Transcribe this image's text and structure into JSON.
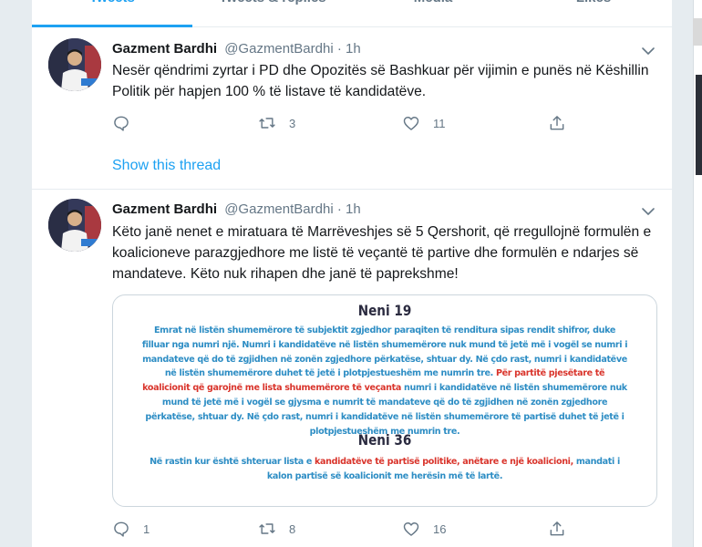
{
  "tabs": [
    {
      "label": "Tweets",
      "active": true
    },
    {
      "label": "Tweets & replies",
      "active": false
    },
    {
      "label": "Media",
      "active": false
    },
    {
      "label": "Likes",
      "active": false
    }
  ],
  "tweets": [
    {
      "name": "Gazment Bardhi",
      "handle": "@GazmentBardhi",
      "dot": "·",
      "time": "1h",
      "text": "Nesër qëndrimi zyrtar i PD dhe Opozitës së Bashkuar për vijimin e punës në Këshillin Politik për hapjen 100 % të listave të kandidatëve.",
      "replies": "",
      "retweets": "3",
      "likes": "11",
      "thread_link": "Show this thread"
    },
    {
      "name": "Gazment Bardhi",
      "handle": "@GazmentBardhi",
      "dot": "·",
      "time": "1h",
      "text": "Këto janë nenet e miratuara të Marrëveshjes së 5 Qershorit, që rregullojnë formulën e koalicioneve parazgjedhore me listë të veçantë të partive dhe formulën e ndarjes së mandateve. Këto nuk rihapen dhe janë të paprekshme!",
      "replies": "1",
      "retweets": "8",
      "likes": "16",
      "media": {
        "title1": "Neni 19",
        "para1_a": "Emrat në listën shumemërore të subjektit zgjedhor paraqiten të renditura sipas rendit shifror, duke filluar nga numri një. Numri i kandidatëve në listën shumemërore nuk mund të jetë më i vogël se numri i mandateve që do të zgjidhen në zonën zgjedhore përkatëse, shtuar dy. Në çdo rast, numri i kandidatëve në listën shumemërore duhet të jetë i plotpjestueshëm me numrin tre.",
        "para1_red": "Për partitë pjesëtare të koalicionit që garojnë me lista shumemërore të veçanta",
        "para1_b": "numri i kandidatëve në listën shumemërore nuk mund të jetë më i vogël se gjysma e numrit të mandateve që do të zgjidhen në zonën zgjedhore përkatëse, shtuar dy. Në çdo rast, numri i kandidatëve në listën shumemërore të partisë duhet të jetë i plotpjestueshëm me numrin tre.",
        "title2": "Neni 36",
        "para2_a": "Në rastin kur është shteruar lista e",
        "para2_red": "kandidatëve të partisë politike, anëtare e një koalicioni,",
        "para2_b": "mandati i kalon partisë së koalicionit me herësin më të lartë."
      }
    }
  ],
  "colors": {
    "accent": "#1da1f2",
    "art_blue": "#2d8dc4",
    "art_red": "#d9342b"
  }
}
